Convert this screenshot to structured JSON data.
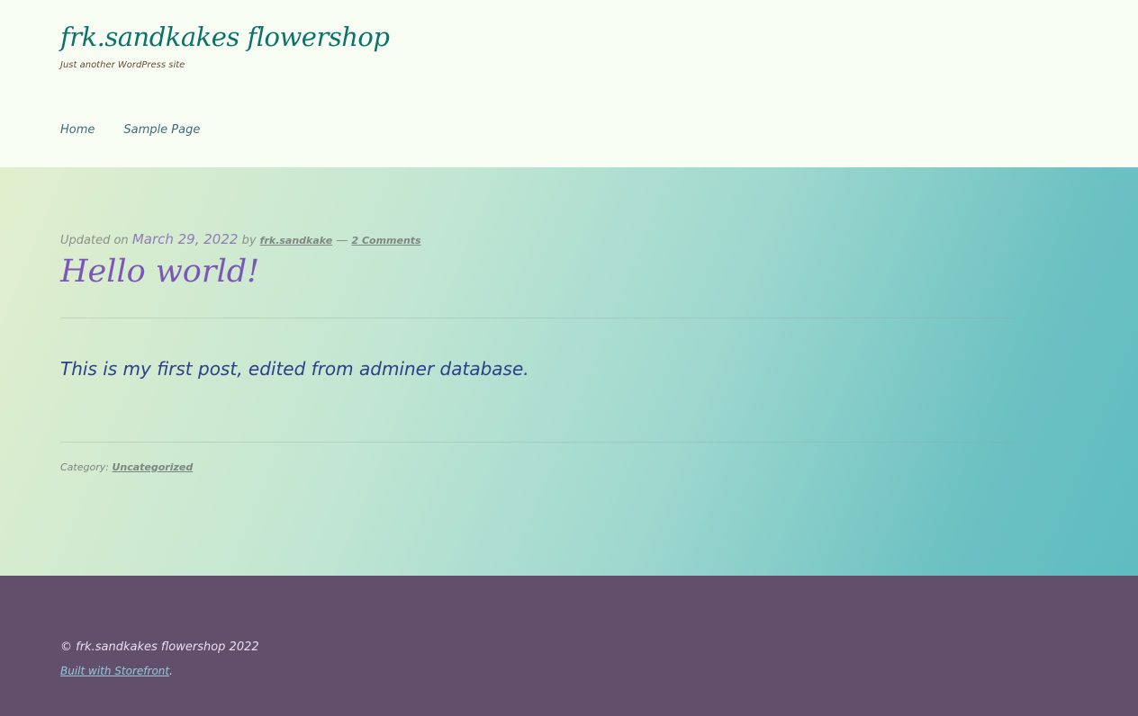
{
  "header": {
    "site_title": "frk.sandkakes flowershop",
    "tagline": "Just another WordPress site",
    "nav": [
      {
        "label": "Home"
      },
      {
        "label": "Sample Page"
      }
    ]
  },
  "post": {
    "updated_prefix": "Updated on",
    "date": "March 29, 2022",
    "by": "by",
    "author": "frk.sandkake",
    "dash": "—",
    "comments": "2 Comments",
    "title": "Hello world!",
    "body": "This is my first post, edited from adminer database.",
    "category_label": "Category:",
    "category": "Uncategorized"
  },
  "footer": {
    "copyright": "© frk.sandkakes flowershop 2022",
    "built_link": "Built with Storefront",
    "built_suffix": "."
  },
  "colors": {
    "header_bg": "#f7fdf2",
    "site_title": "#0b7369",
    "post_title": "#7b58b8",
    "post_body": "#2c3f8a",
    "footer_bg": "#624f6b"
  }
}
